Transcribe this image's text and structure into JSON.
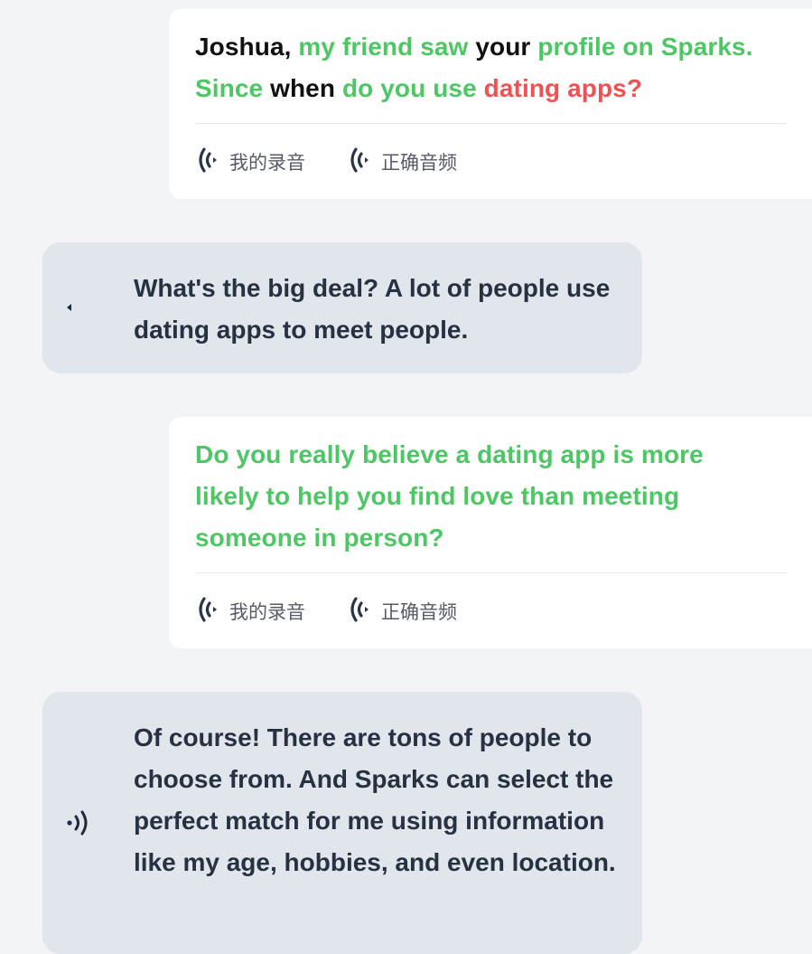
{
  "conversation": [
    {
      "type": "prompt",
      "segments": [
        {
          "text": "Joshua,",
          "status": "black"
        },
        {
          "text": " ",
          "status": "black"
        },
        {
          "text": "my friend saw",
          "status": "green"
        },
        {
          "text": " ",
          "status": "black"
        },
        {
          "text": "your",
          "status": "black"
        },
        {
          "text": " ",
          "status": "black"
        },
        {
          "text": "profile on Sparks.",
          "status": "green"
        },
        {
          "text": "Since",
          "status": "green",
          "newline": true
        },
        {
          "text": " ",
          "status": "black"
        },
        {
          "text": "when",
          "status": "black"
        },
        {
          "text": " ",
          "status": "black"
        },
        {
          "text": "do you use",
          "status": "green"
        },
        {
          "text": " ",
          "status": "black"
        },
        {
          "text": "dating apps?",
          "status": "red"
        }
      ],
      "my_recording_label": "我的录音",
      "correct_audio_label": "正确音频"
    },
    {
      "type": "reply",
      "text": "What's the big deal? A lot of people use dating apps to meet people.",
      "icon": "play-dot-icon"
    },
    {
      "type": "prompt",
      "segments": [
        {
          "text": "Do you really believe a dating app is more likely to help you find love than meeting someone in person?",
          "status": "green"
        }
      ],
      "my_recording_label": "我的录音",
      "correct_audio_label": "正确音频"
    },
    {
      "type": "reply",
      "text": "Of course! There are tons of people to choose from. And Sparks can select the perfect match for me using information like my age, hobbies, and even location.",
      "icon": "speaker-waves-icon"
    }
  ],
  "colors": {
    "correct": "#4dc764",
    "incorrect": "#ee5252",
    "neutral": "#111111",
    "reply_bg": "#e1e5ec",
    "page_bg": "#f3f4f6"
  }
}
